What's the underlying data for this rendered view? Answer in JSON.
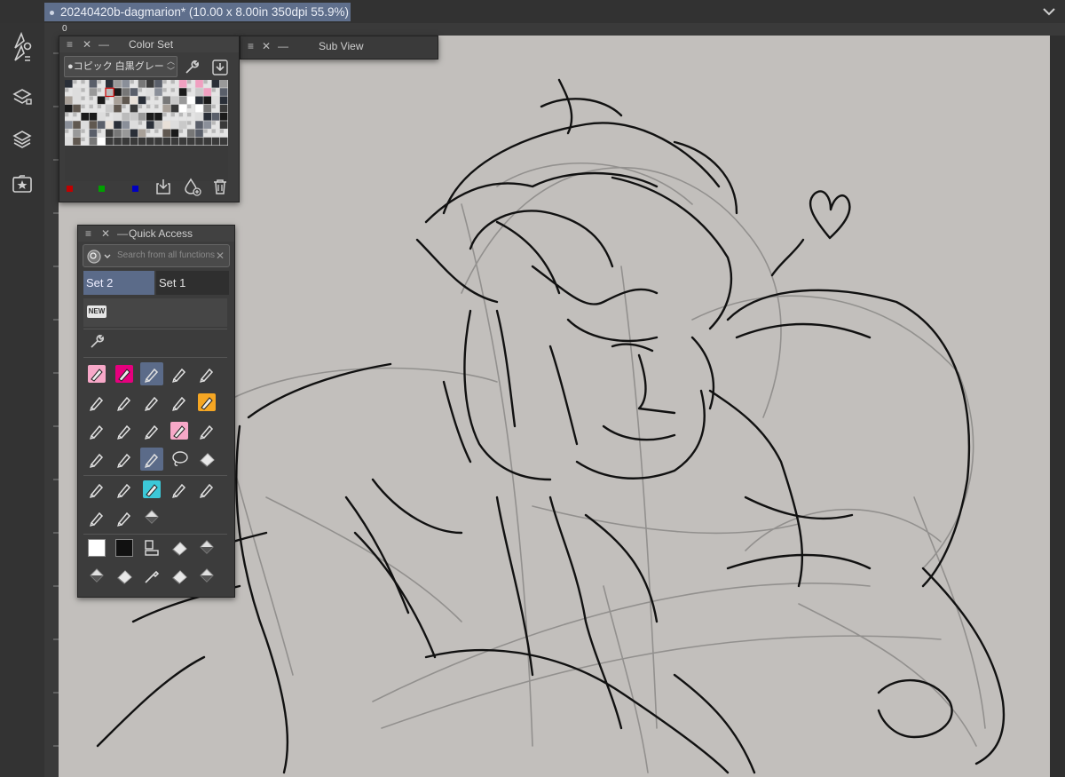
{
  "document_tab": {
    "title": "20240420b-dagmarion* (10.00 x 8.00in 350dpi 55.9%)"
  },
  "ruler": {
    "zero_label": "0"
  },
  "sidebar": {
    "items": [
      {
        "icon": "brush-settings-icon"
      },
      {
        "icon": "sub-tool-detail-icon"
      },
      {
        "icon": "layer-property-icon"
      },
      {
        "icon": "layers-icon"
      },
      {
        "icon": "material-star-icon"
      }
    ]
  },
  "color_set_panel": {
    "title": "Color Set",
    "set_name": "●コピック 白黒グレー",
    "footer_colors": [
      "#c00000",
      "#00a000",
      "#0000c0"
    ],
    "icons": [
      "wrench-icon",
      "download-icon",
      "import-icon",
      "add-color-icon",
      "trash-icon"
    ]
  },
  "sub_view_panel": {
    "title": "Sub View"
  },
  "quick_access_panel": {
    "title": "Quick Access",
    "search_placeholder": "Search from all functions",
    "tabs": [
      {
        "label": "Set 2",
        "selected": true
      },
      {
        "label": "Set 1",
        "selected": false
      }
    ],
    "new_badge": "NEW"
  },
  "colors": {
    "accent": "#5f6f8c",
    "canvas": "#c2bfbc",
    "panel": "#3c3c3c"
  }
}
